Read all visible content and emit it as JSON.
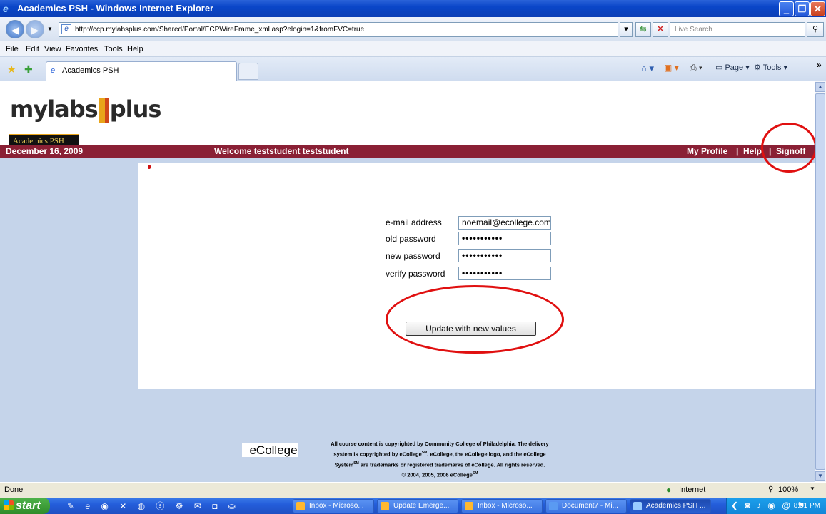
{
  "window": {
    "title": "Academics PSH - Windows Internet Explorer"
  },
  "address_bar": {
    "url": "http://ccp.mylabsplus.com/Shared/Portal/ECPWireFrame_xml.asp?elogin=1&fromFVC=true",
    "search_placeholder": "Live Search"
  },
  "menu": {
    "items": [
      "File",
      "Edit",
      "View",
      "Favorites",
      "Tools",
      "Help"
    ]
  },
  "tabs": {
    "active": "Academics PSH"
  },
  "toolbar": {
    "page_label": "Page",
    "tools_label": "Tools"
  },
  "site": {
    "logo_left": "mylabs",
    "logo_right": "plus",
    "course_tab": "Academics PSH",
    "date": "December 16, 2009",
    "welcome": "Welcome teststudent teststudent",
    "nav": {
      "profile": "My Profile",
      "sep": "|",
      "help": "Help",
      "signoff": "Signoff"
    }
  },
  "form": {
    "email_label": "e-mail address",
    "email_value": "noemail@ecollege.com",
    "old_label": "old password",
    "old_value": "•••••••••••",
    "new_label": "new password",
    "new_value": "•••••••••••",
    "verify_label": "verify password",
    "verify_value": "•••••••••••",
    "submit": "Update with new values"
  },
  "footer": {
    "brand": "eCollege",
    "line1": "All course content is copyrighted by Community College of Philadelphia. The delivery",
    "line2": "system is copyrighted by eCollege",
    "line2b": ". eCollege, the eCollege logo, and the eCollege",
    "line3": "System",
    "line3b": " are trademarks or registered trademarks of eCollege. All rights reserved.",
    "line4": "© 2004, 2005, 2006 eCollege",
    "sm": "SM"
  },
  "status": {
    "text": "Done",
    "zone": "Internet",
    "zoom": "100%"
  },
  "taskbar": {
    "start": "start",
    "tasks": [
      "Inbox - Microso...",
      "Update Emerge...",
      "Inbox - Microso...",
      "Document7 - Mi...",
      "Academics PSH ..."
    ],
    "clock": "8:51 PM"
  }
}
